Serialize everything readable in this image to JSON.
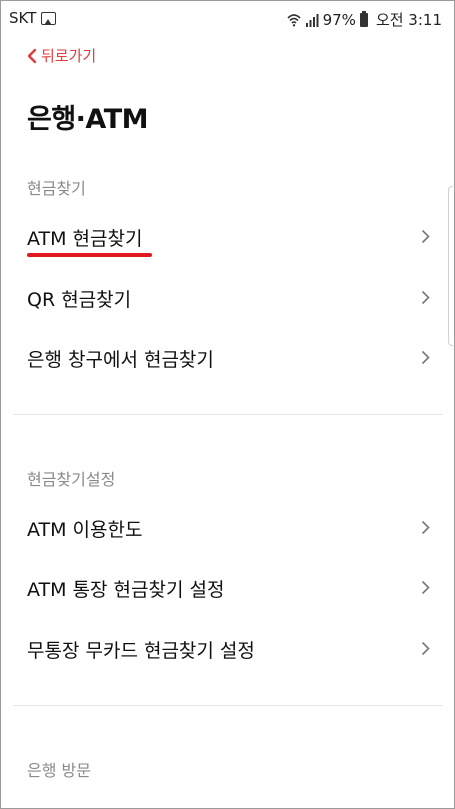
{
  "status_bar": {
    "carrier": "SKT",
    "battery": "97%",
    "time": "오전 3:11"
  },
  "nav": {
    "back_label": "뒤로가기"
  },
  "page": {
    "title": "은행·ATM"
  },
  "sections": [
    {
      "header": "현금찾기",
      "items": [
        {
          "label": "ATM 현금찾기"
        },
        {
          "label": "QR 현금찾기"
        },
        {
          "label": "은행 창구에서 현금찾기"
        }
      ]
    },
    {
      "header": "현금찾기설정",
      "items": [
        {
          "label": "ATM 이용한도"
        },
        {
          "label": "ATM 통장 현금찾기 설정"
        },
        {
          "label": "무통장 무카드 현금찾기 설정"
        }
      ]
    },
    {
      "header": "은행 방문",
      "items": []
    }
  ],
  "colors": {
    "accent": "#e13c3c",
    "underline": "#e0191f",
    "section_header": "#8a8a8a"
  }
}
